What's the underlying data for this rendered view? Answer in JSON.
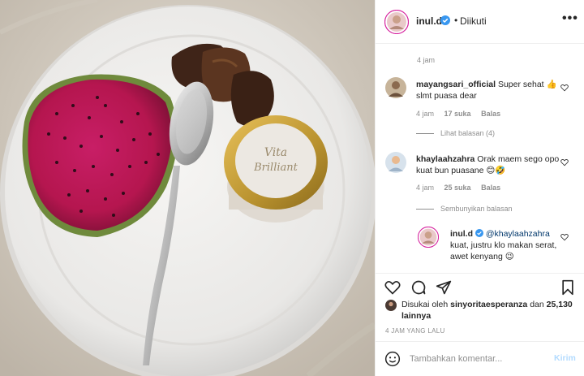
{
  "post": {
    "image_description_alt": "",
    "accent_color": "#0095f6"
  },
  "header": {
    "username": "inul.d",
    "separator": "•",
    "follow_label": "Diikuti",
    "more_icon": "more-horizontal-icon"
  },
  "caption": {
    "time": "4 jam"
  },
  "comments": [
    {
      "username": "mayangsari_official",
      "text": "Super sehat 👍 slmt puasa dear",
      "time": "4 jam",
      "likes": "17 suka",
      "reply_label": "Balas",
      "view_replies": "Lihat balasan (4)"
    },
    {
      "username": "khaylaahzahra",
      "text": "Orak maem sego opo kuat bun puasane 😊🤣",
      "time": "4 jam",
      "likes": "25 suka",
      "reply_label": "Balas",
      "hide_replies": "Sembunyikan balasan"
    }
  ],
  "reply": {
    "username": "inul.d",
    "mention": "@khaylaahzahra",
    "text": "kuat, justru klo makan serat, awet kenyang 😉"
  },
  "likes": {
    "prefix": "Disukai oleh",
    "user": "sinyoritaesperanza",
    "conj": "dan",
    "count": "25,130 lainnya"
  },
  "timestamp": "4 JAM YANG LALU",
  "add_comment": {
    "placeholder": "Tambahkan komentar...",
    "send_label": "Kirim"
  },
  "photo": {
    "jar_label_line1": "Vita",
    "jar_label_line2": "Brilliant"
  }
}
